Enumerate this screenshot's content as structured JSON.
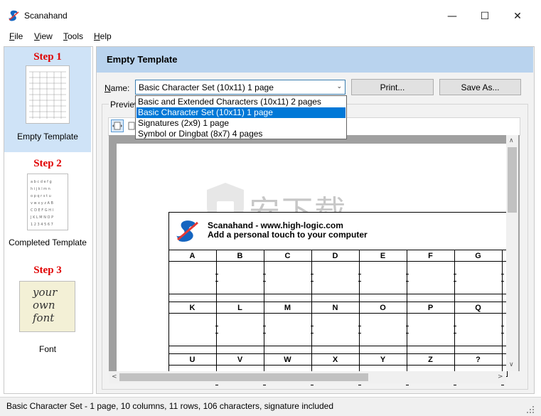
{
  "window": {
    "title": "Scanahand",
    "minimize_glyph": "—",
    "maximize_glyph": "☐",
    "close_glyph": "✕"
  },
  "menu": [
    {
      "label": "File",
      "underline": "F",
      "rest": "ile"
    },
    {
      "label": "View",
      "underline": "V",
      "rest": "iew"
    },
    {
      "label": "Tools",
      "underline": "T",
      "rest": "ools"
    },
    {
      "label": "Help",
      "underline": "H",
      "rest": "elp"
    }
  ],
  "steps": [
    {
      "title": "Step 1",
      "label": "Empty Template",
      "selected": true
    },
    {
      "title": "Step 2",
      "label": "Completed Template",
      "selected": false
    },
    {
      "title": "Step 3",
      "label": "Font",
      "selected": false,
      "thumb_text": [
        "your",
        "own",
        "font"
      ]
    }
  ],
  "panel": {
    "title": "Empty Template",
    "name_label": "Name:",
    "name_value": "Basic Character Set (10x11) 1 page",
    "print_label": "Print...",
    "save_label": "Save As...",
    "preview_label": "Preview"
  },
  "dropdown": {
    "options": [
      "Basic and Extended Characters (10x11) 2 pages",
      "Basic Character Set (10x11) 1 page",
      "Signatures (2x9) 1 page",
      "Symbol or Dingbat (8x7) 4 pages"
    ],
    "selected_index": 1
  },
  "template": {
    "url_line": "Scanahand - www.high-logic.com",
    "tagline": "Add a personal touch to your computer",
    "rows": [
      [
        "A",
        "B",
        "C",
        "D",
        "E",
        "F",
        "G"
      ],
      [
        "K",
        "L",
        "M",
        "N",
        "O",
        "P",
        "Q"
      ],
      [
        "U",
        "V",
        "W",
        "X",
        "Y",
        "Z",
        "?"
      ]
    ]
  },
  "watermark": "安下载",
  "status": "Basic Character Set - 1 page, 10 columns, 11 rows, 106 characters, signature included",
  "colors": {
    "accent": "#0078d7",
    "header_band": "#b9d3ee",
    "step_selected": "#cfe3f7",
    "step_title": "#e00000"
  }
}
